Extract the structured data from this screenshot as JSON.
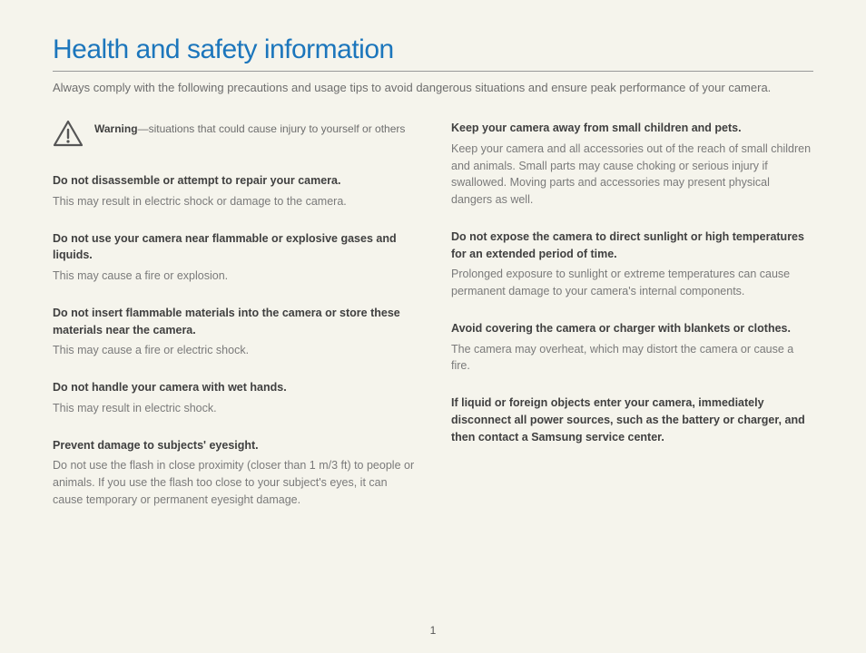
{
  "title": "Health and safety information",
  "intro": "Always comply with the following precautions and usage tips to avoid dangerous situations and ensure peak performance of your camera.",
  "warning": {
    "label": "Warning",
    "desc": "—situations that could cause injury to yourself or others"
  },
  "left_sections": [
    {
      "head": "Do not disassemble or attempt to repair your camera.",
      "body": "This may result in electric shock or damage to the camera."
    },
    {
      "head": "Do not use your camera near flammable or explosive gases and liquids.",
      "body": "This may cause a fire or explosion."
    },
    {
      "head": "Do not insert flammable materials into the camera or store these materials near the camera.",
      "body": "This may cause a fire or electric shock."
    },
    {
      "head": "Do not handle your camera with wet hands.",
      "body": "This may result in electric shock."
    },
    {
      "head": "Prevent damage to subjects' eyesight.",
      "body": "Do not use the flash in close proximity (closer than 1 m/3 ft) to people or animals. If you use the flash too close to your subject's eyes, it can cause temporary or permanent eyesight damage."
    }
  ],
  "right_sections": [
    {
      "head": "Keep your camera away from small children and pets.",
      "body": "Keep your camera and all accessories out of the reach of small children and animals. Small parts may cause choking or serious injury if swallowed. Moving parts and accessories may present physical dangers as well."
    },
    {
      "head": "Do not expose the camera to direct sunlight or high temperatures for an extended period of time.",
      "body": "Prolonged exposure to sunlight or extreme temperatures can cause permanent damage to your camera's internal components."
    },
    {
      "head": "Avoid covering the camera or charger with blankets or clothes.",
      "body": "The camera may overheat, which may distort the camera or cause a fire."
    },
    {
      "head": "If liquid or foreign objects enter your camera, immediately disconnect all power sources, such as the battery or charger, and then contact a Samsung service center.",
      "body": ""
    }
  ],
  "page_number": "1"
}
